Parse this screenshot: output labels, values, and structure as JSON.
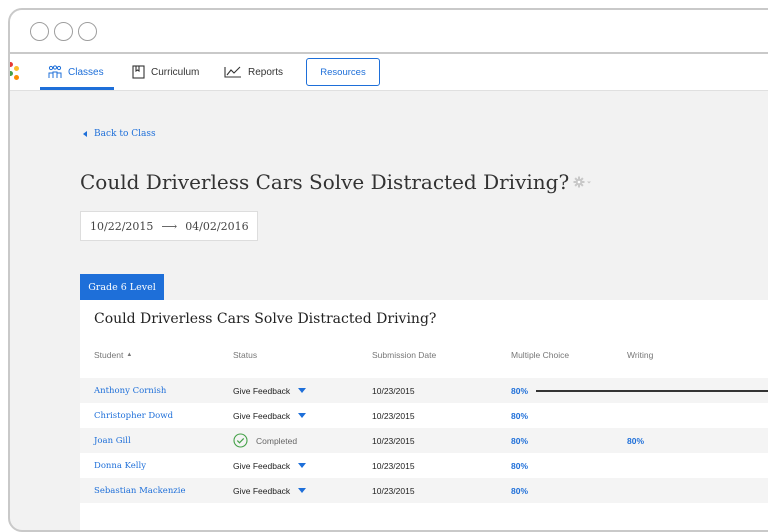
{
  "nav": {
    "tabs": [
      {
        "label": "Classes",
        "icon": "classes-icon"
      },
      {
        "label": "Curriculum",
        "icon": "curriculum-icon"
      },
      {
        "label": "Reports",
        "icon": "reports-icon"
      }
    ],
    "resources_label": "Resources",
    "active_tab": "Classes"
  },
  "back_label": "Back to Class",
  "page_title": "Could Driverless Cars Solve Distracted Driving?",
  "dates": {
    "start": "10/22/2015",
    "end": "04/02/2016"
  },
  "grade_tab": "Grade 6 Level",
  "card_title": "Could Driverless Cars Solve Distracted Driving?",
  "columns": [
    "Student",
    "Status",
    "Submission Date",
    "Multiple Choice",
    "Writing"
  ],
  "rows": [
    {
      "student": "Anthony Cornish",
      "status": "Give Feedback",
      "date": "10/23/2015",
      "mc": "80%",
      "writing": ""
    },
    {
      "student": "Christopher Dowd",
      "status": "Give Feedback",
      "date": "10/23/2015",
      "mc": "80%",
      "writing": ""
    },
    {
      "student": "Joan Gill",
      "status": "Completed",
      "date": "10/23/2015",
      "mc": "80%",
      "writing": "80%"
    },
    {
      "student": "Donna Kelly",
      "status": "Give Feedback",
      "date": "10/23/2015",
      "mc": "80%",
      "writing": ""
    },
    {
      "student": "Sebastian Mackenzie",
      "status": "Give Feedback",
      "date": "10/23/2015",
      "mc": "80%",
      "writing": ""
    }
  ],
  "colors": {
    "accent": "#1e6fd9",
    "background": "#f2f2f2",
    "row_alt": "#f4f4f4"
  }
}
